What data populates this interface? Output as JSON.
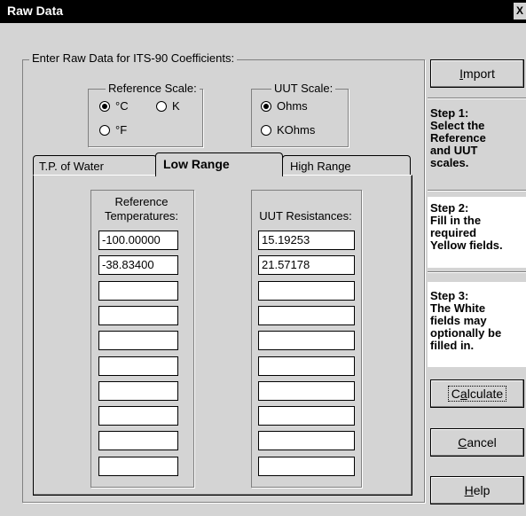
{
  "window": {
    "title": "Raw Data",
    "close_symbol": "X"
  },
  "group": {
    "legend": "Enter Raw Data for ITS-90 Coefficients:"
  },
  "reference_scale": {
    "legend": "Reference Scale:",
    "options": [
      {
        "label": "°C",
        "selected": true
      },
      {
        "label": "K",
        "selected": false
      },
      {
        "label": "°F",
        "selected": false
      }
    ]
  },
  "uut_scale": {
    "legend": "UUT Scale:",
    "options": [
      {
        "label": "Ohms",
        "selected": true
      },
      {
        "label": "KOhms",
        "selected": false
      }
    ]
  },
  "tabs": [
    {
      "label": "T.P. of Water",
      "active": false
    },
    {
      "label": "Low Range",
      "active": true
    },
    {
      "label": "High Range",
      "active": false
    }
  ],
  "table": {
    "ref_header_line1": "Reference",
    "ref_header_line2": "Temperatures:",
    "uut_header": "UUT Resistances:",
    "ref_values": [
      "-100.00000",
      "-38.83400",
      "",
      "",
      "",
      "",
      "",
      "",
      "",
      ""
    ],
    "uut_values": [
      "15.19253",
      "21.57178",
      "",
      "",
      "",
      "",
      "",
      "",
      "",
      ""
    ]
  },
  "buttons": {
    "import": {
      "underline": "I",
      "rest": "mport"
    },
    "calculate": {
      "pre": "C",
      "underline": "a",
      "rest": "lculate"
    },
    "cancel": {
      "underline": "C",
      "rest": "ancel"
    },
    "help": {
      "underline": "H",
      "rest": "elp"
    }
  },
  "steps": {
    "step1": [
      "Step 1:",
      "Select the",
      "Reference",
      "and UUT",
      "scales."
    ],
    "step2": [
      "Step 2:",
      "Fill in the",
      "required",
      "Yellow fields."
    ],
    "step3": [
      "Step 3:",
      "The White",
      "fields may",
      "optionally be",
      "filled in."
    ]
  }
}
